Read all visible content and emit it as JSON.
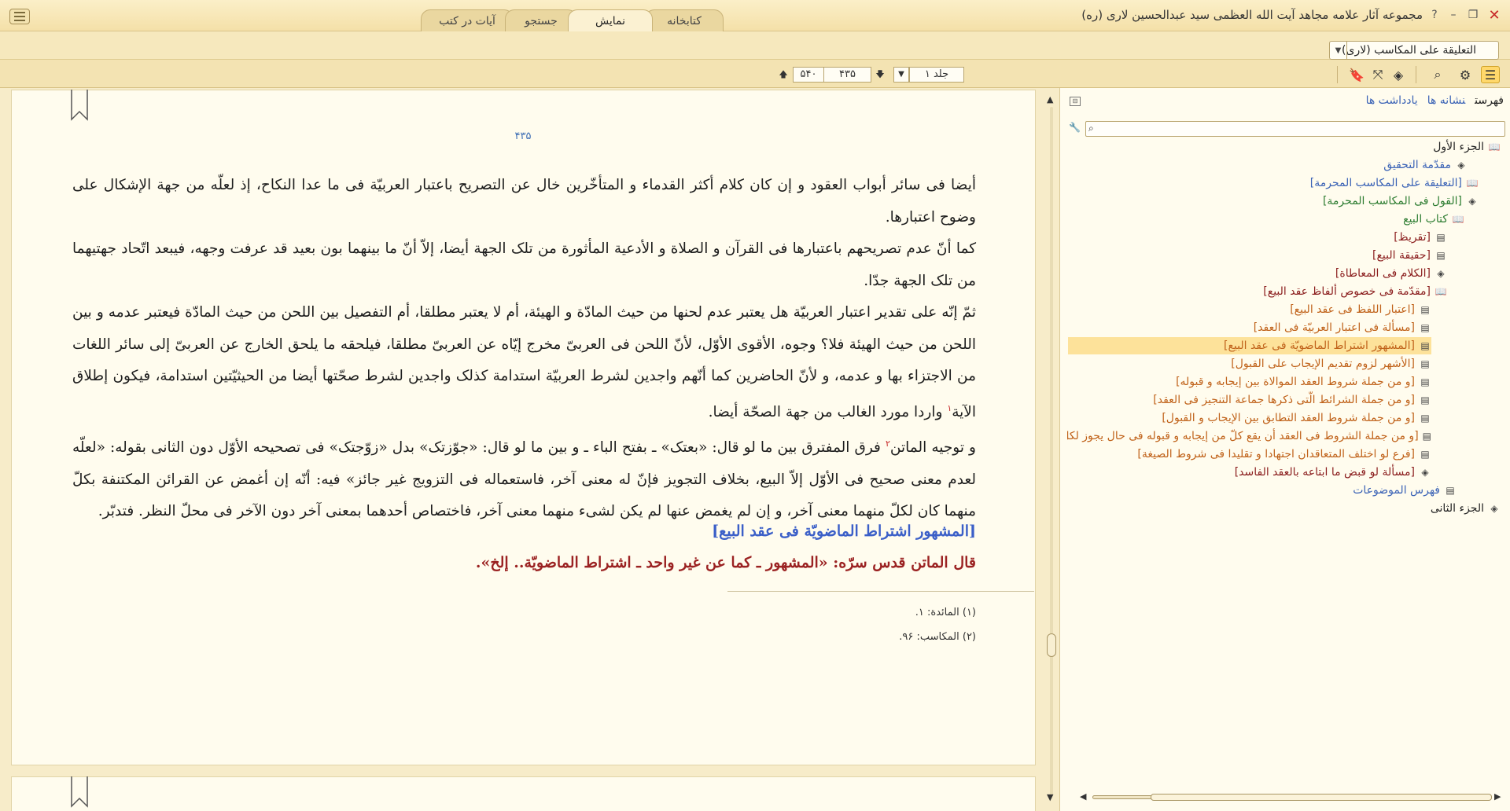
{
  "app": {
    "title": "مجموعه آثار علامه مجاهد آیت الله العظمی سید عبدالحسین لاری (ره)"
  },
  "tabs": [
    {
      "label": "کتابخانه"
    },
    {
      "label": "نمایش"
    },
    {
      "label": "جستجو"
    },
    {
      "label": "آیات در کتب"
    }
  ],
  "book": {
    "selected": "التعلیقة علی المکاسب (لاری)"
  },
  "toolbar": {
    "volume": "جلد ۱",
    "current_page": "۴۳۵",
    "total_pages": "۵۴۰"
  },
  "page": {
    "number": "۴۳۵",
    "paragraphs": [
      {
        "text": "أیضا فی سائر أبواب العقود و إن کان کلام أکثر القدماء و المتأخّرین خال عن التصریح باعتبار العربیّة فی ما عدا النکاح، إذ لعلّه من جهة الإشکال علی وضوح اعتبارها.",
        "sup": "",
        "after": ""
      },
      {
        "text": "کما أنّ عدم تصریحهم باعتبارها فی القرآن و الصلاة و الأدعیة المأثورة من تلک الجهة أیضا، إلاّ أنّ ما بینهما بون بعید قد عرفت وجهه، فیبعد اتّحاد جهتیهما من تلک الجهة جدّا.",
        "sup": "",
        "after": ""
      },
      {
        "text": "ثمّ إنّه علی تقدیر اعتبار العربیّة هل یعتبر عدم لحنها من حیث المادّة و الهیئة، أم لا یعتبر مطلقا، أم التفصیل بین اللحن من حیث المادّة فیعتبر عدمه و بین اللحن من حیث الهیئة فلا؟ وجوه، الأقوی الأوّل، لأنّ اللحن فی العربیّ مخرج إیّاه عن العربیّ مطلقا، فیلحقه ما یلحق الخارج عن العربیّ إلی سائر اللغات من الاجتزاء بها و عدمه، و لأنّ الحاضرین کما أنّهم واجدین لشرط العربیّة استدامة کذلک واجدین لشرط صحّتها أیضا من الحیثیّتین استدامة، فیکون إطلاق الآیة",
        "sup": "۱",
        "after": " واردا مورد الغالب من جهة الصحّة أیضا."
      },
      {
        "text": "و توجیه الماتن",
        "sup": "۲",
        "after": " فرق المفترق بین ما لو قال: «بعتک» ـ بفتح الباء ـ و بین ما لو قال: «جوّزتک» بدل «زوّجتک» فی تصحیحه الأوّل دون الثانی بقوله: «لعلّه لعدم معنی صحیح فی الأوّل إلاّ البیع، بخلاف التجویز فإنّ له معنی آخر، فاستعماله فی التزویج غیر جائز» فیه: أنّه إن أغمض عن القرائن المکتنفة بکلّ منهما کان لکلّ منهما معنی آخر، و إن لم یغمض عنها لم یکن لشیء منهما معنی آخر، فاختصاص أحدهما بمعنی آخر دون الآخر فی محلّ النظر. فتدبّر."
      }
    ],
    "section_heading": "[المشهور اشتراط الماضویّة فی عقد البیع]",
    "matn_quote": "قال الماتن قدس سرّه: «المشهور ـ کما عن غیر واحد ـ اشتراط الماضویّة.. إلخ».",
    "footnotes": [
      "(۱) المائدة: ۱.",
      "(۲) المکاسب: ۹۶."
    ]
  },
  "toc": {
    "tabs": [
      "فهرست",
      "نشانه ها",
      "یادداشت ها"
    ],
    "search_placeholder": "",
    "items": [
      {
        "label": "الجزء الأول",
        "icon": "book-open-icon",
        "glyph": "📖",
        "color": "#222"
      },
      {
        "label": "مقدّمة التحقیق",
        "icon": "layers-icon",
        "glyph": "◈",
        "color": "#3b63b6"
      },
      {
        "label": "[التعلیقة علی المکاسب المحرمة]",
        "icon": "book-open-icon",
        "glyph": "📖",
        "color": "#3b63b6"
      },
      {
        "label": "[القول فی المکاسب المحرمة]",
        "icon": "layers-icon",
        "glyph": "◈",
        "color": "#2e7d32"
      },
      {
        "label": "کتاب البیع",
        "icon": "book-open-icon",
        "glyph": "📖",
        "color": "#2e7d32"
      },
      {
        "label": "[تقریظ]",
        "icon": "document-icon",
        "glyph": "▤",
        "color": "#8b1e1e"
      },
      {
        "label": "[حقیقة البیع]",
        "icon": "document-icon",
        "glyph": "▤",
        "color": "#8b1e1e"
      },
      {
        "label": "[الکلام فی المعاطاة]",
        "icon": "layers-icon",
        "glyph": "◈",
        "color": "#8b1e1e"
      },
      {
        "label": "[مقدّمة فی خصوص ألفاظ عقد البیع]",
        "icon": "book-open-icon",
        "glyph": "📖",
        "color": "#8b1e1e"
      },
      {
        "label": "[اعتبار اللفظ فی عقد البیع]",
        "icon": "document-icon",
        "glyph": "▤",
        "color": "#c0621a"
      },
      {
        "label": "[مسألة فی اعتبار العربیّة فی العقد]",
        "icon": "document-icon",
        "glyph": "▤",
        "color": "#c0621a"
      },
      {
        "label": "[المشهور اشتراط الماضویّة فی عقد البیع]",
        "icon": "document-icon",
        "glyph": "▤",
        "color": "#c0621a"
      },
      {
        "label": "[الأشهر لزوم تقدیم الإیجاب علی القبول]",
        "icon": "document-icon",
        "glyph": "▤",
        "color": "#c0621a"
      },
      {
        "label": "[و من جملة شروط العقد الموالاة بین إیجابه و قبوله]",
        "icon": "document-icon",
        "glyph": "▤",
        "color": "#c0621a"
      },
      {
        "label": "[و من جملة الشرائط الّتی ذکرها جماعة التنجیز فی العقد]",
        "icon": "document-icon",
        "glyph": "▤",
        "color": "#c0621a"
      },
      {
        "label": "[و من جملة شروط العقد التطابق بین الإیجاب و القبول]",
        "icon": "document-icon",
        "glyph": "▤",
        "color": "#c0621a"
      },
      {
        "label": "[و من جملة الشروط فی العقد أن یقع کلّ من إیجابه و قبوله فی حال یجوز لکلّ واحد",
        "icon": "document-icon",
        "glyph": "▤",
        "color": "#c0621a"
      },
      {
        "label": "[فرع لو اختلف المتعاقدان اجتهادا و تقلیدا فی شروط الصیغة]",
        "icon": "document-icon",
        "glyph": "▤",
        "color": "#c0621a"
      },
      {
        "label": "[مسألة لو قبض ما ابتاعه بالعقد الفاسد]",
        "icon": "layers-icon",
        "glyph": "◈",
        "color": "#8b1e1e"
      },
      {
        "label": "فهرس الموضوعات",
        "icon": "document-icon",
        "glyph": "▤",
        "color": "#3b63b6"
      },
      {
        "label": "الجزء الثانی",
        "icon": "layers-icon",
        "glyph": "◈",
        "color": "#222"
      }
    ],
    "selected_index": 11
  }
}
